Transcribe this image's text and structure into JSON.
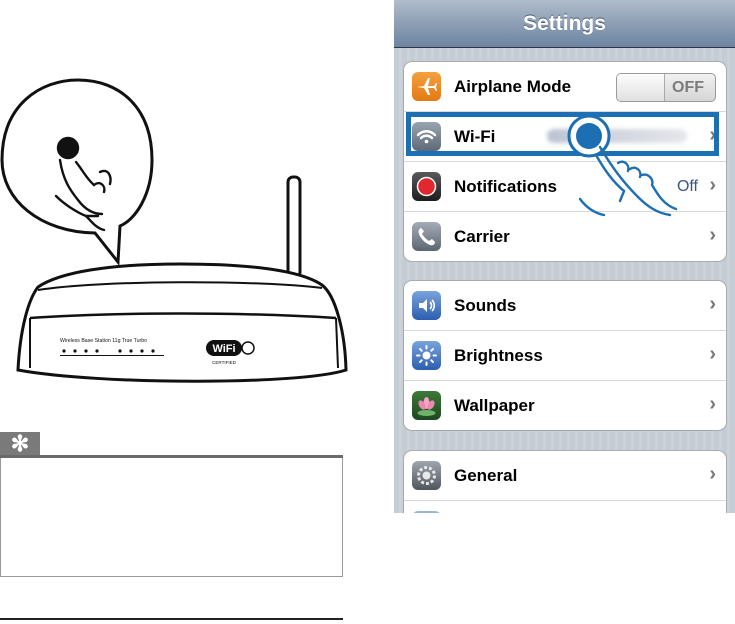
{
  "settings": {
    "title": "Settings",
    "groups": [
      {
        "rows": [
          {
            "label": "Airplane Mode",
            "toggle_text": "OFF",
            "icon": "airplane-icon"
          },
          {
            "label": "Wi-Fi",
            "icon": "wifi-icon"
          },
          {
            "label": "Notifications",
            "value": "Off",
            "icon": "notifications-icon"
          },
          {
            "label": "Carrier",
            "icon": "phone-icon"
          }
        ]
      },
      {
        "rows": [
          {
            "label": "Sounds",
            "icon": "speaker-icon"
          },
          {
            "label": "Brightness",
            "icon": "sun-icon"
          },
          {
            "label": "Wallpaper",
            "icon": "flower-icon"
          }
        ]
      },
      {
        "rows": [
          {
            "label": "General",
            "icon": "gear-icon"
          }
        ]
      }
    ]
  },
  "router": {
    "model_text": "Wireless Base Station 11g True Turbo",
    "badge": "WiFi",
    "badge_sub": "CERTIFIED"
  },
  "tip": {
    "icon": "asterisk-icon"
  },
  "colors": {
    "highlight": "#1d6fb4",
    "navbar": "#6d84a2",
    "value_text": "#385487"
  }
}
